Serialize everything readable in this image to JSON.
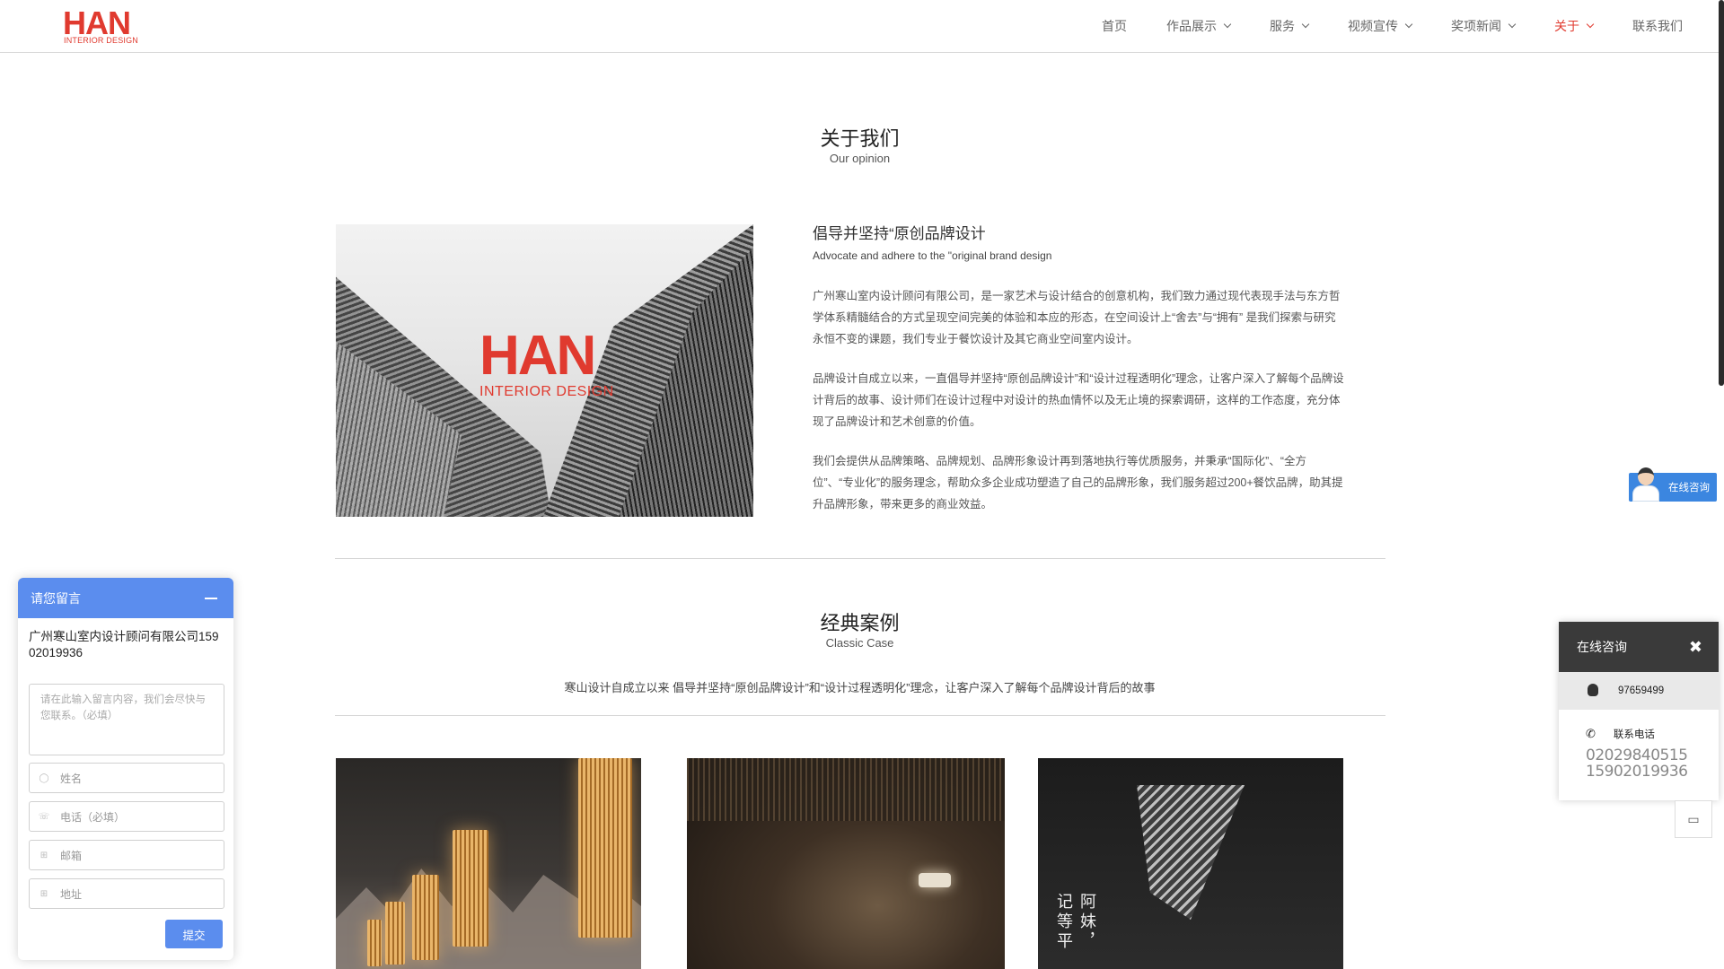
{
  "logo": {
    "main": "HAN",
    "sub": "INTERIOR DESIGN"
  },
  "nav": [
    {
      "label": "首页",
      "dropdown": false,
      "active": false
    },
    {
      "label": "作品展示",
      "dropdown": true,
      "active": false
    },
    {
      "label": "服务",
      "dropdown": true,
      "active": false
    },
    {
      "label": "视频宣传",
      "dropdown": true,
      "active": false
    },
    {
      "label": "奖项新闻",
      "dropdown": true,
      "active": false
    },
    {
      "label": "关于",
      "dropdown": true,
      "active": true
    },
    {
      "label": "联系我们",
      "dropdown": false,
      "active": false
    }
  ],
  "about": {
    "title": "关于我们",
    "subtitle": "Our opinion",
    "image_logo_main": "HAN",
    "image_logo_sub": "INTERIOR DESIGN",
    "heading": "倡导并坚持“原创品牌设计",
    "heading_en": "Advocate and adhere to the \"original brand design",
    "paragraphs": [
      "广州寒山室内设计顾问有限公司，是一家艺术与设计结合的创意机构，我们致力通过现代表现手法与东方哲学体系精髓结合的方式呈现空间完美的体验和本应的形态，在空间设计上“舍去”与“拥有” 是我们探索与研究永恒不变的课题，我们专业于餐饮设计及其它商业空间室内设计。",
      "品牌设计自成立以来，一直倡导并坚持“原创品牌设计”和“设计过程透明化”理念，让客户深入了解每个品牌设计背后的故事、设计师们在设计过程中对设计的热血情怀以及无止境的探索调研，这样的工作态度，充分体现了品牌设计和艺术创意的价值。",
      "我们会提供从品牌策略、品牌规划、品牌形象设计再到落地执行等优质服务，并秉承“国际化”、“全方位”、“专业化”的服务理念，帮助众多企业成功塑造了自己的品牌形象，我们服务超过200+餐饮品牌，助其提升品牌形象，带来更多的商业效益。"
    ]
  },
  "cases": {
    "title": "经典案例",
    "subtitle": "Classic Case",
    "description": "寒山设计自成立以来 倡导并坚持“原创品牌设计”和“设计过程透明化”理念，让客户深入了解每个品牌设计背后的故事",
    "case3_vertical_text": "阿妹，记等平"
  },
  "message_box": {
    "title": "请您留言",
    "company": "广州寒山室内设计顾问有限公司15902019936",
    "textarea_placeholder": "请在此输入留言内容，我们会尽快与您联系。（必填）",
    "name_placeholder": "姓名",
    "phone_placeholder": "电话（必填）",
    "email_placeholder": "邮箱",
    "address_placeholder": "地址",
    "submit_label": "提交"
  },
  "consult_tag": {
    "label": "在线咨询"
  },
  "consult_panel": {
    "title": "在线咨询",
    "qq": "97659499",
    "tel_label": "联系电话",
    "tel_1": "02029840515",
    "tel_2": "15902019936"
  },
  "colors": {
    "brand_red": "#e03a2f",
    "accent_blue": "#5b8dee",
    "panel_dark": "#3a3a3a"
  }
}
